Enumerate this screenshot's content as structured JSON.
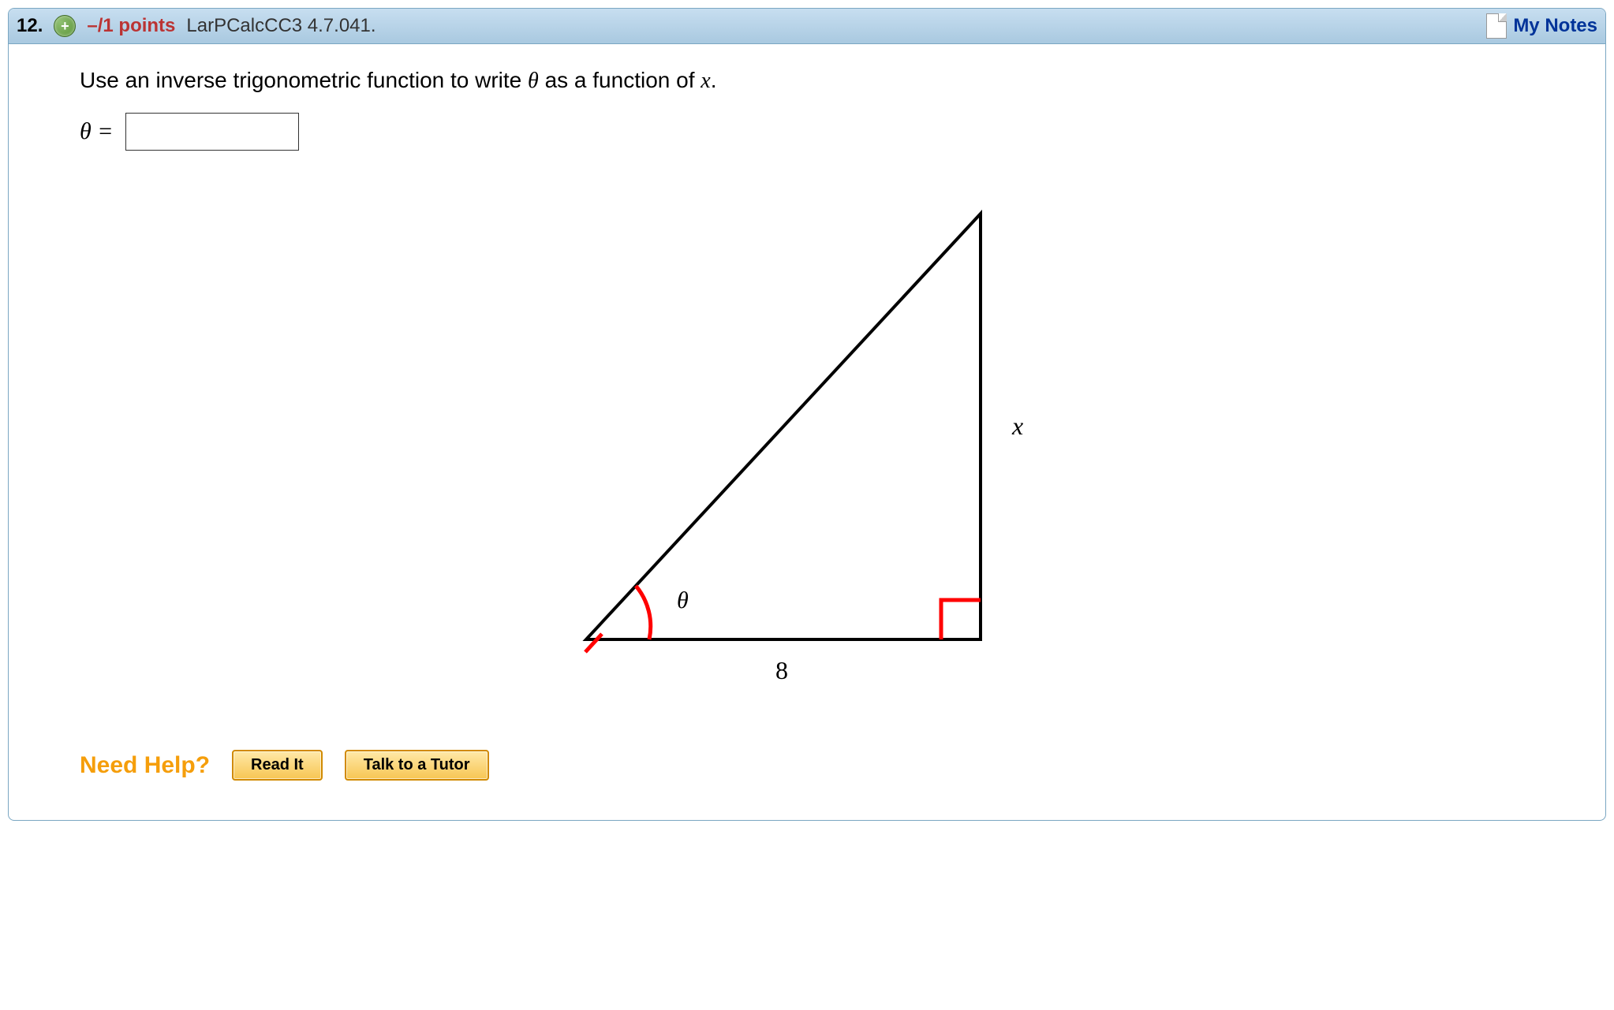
{
  "header": {
    "question_number": "12.",
    "expand": "+",
    "points": "–/1 points",
    "source": "LarPCalcCC3 4.7.041.",
    "my_notes": "My Notes"
  },
  "problem": {
    "prompt_pre": "Use an inverse trigonometric function to write ",
    "theta": "θ",
    "prompt_mid": " as a function of ",
    "var": "x",
    "prompt_post": ".",
    "theta_equals": "θ ="
  },
  "figure": {
    "side_opposite": "x",
    "side_adjacent": "8",
    "angle_label": "θ"
  },
  "help": {
    "label": "Need Help?",
    "read": "Read It",
    "tutor": "Talk to a Tutor"
  }
}
